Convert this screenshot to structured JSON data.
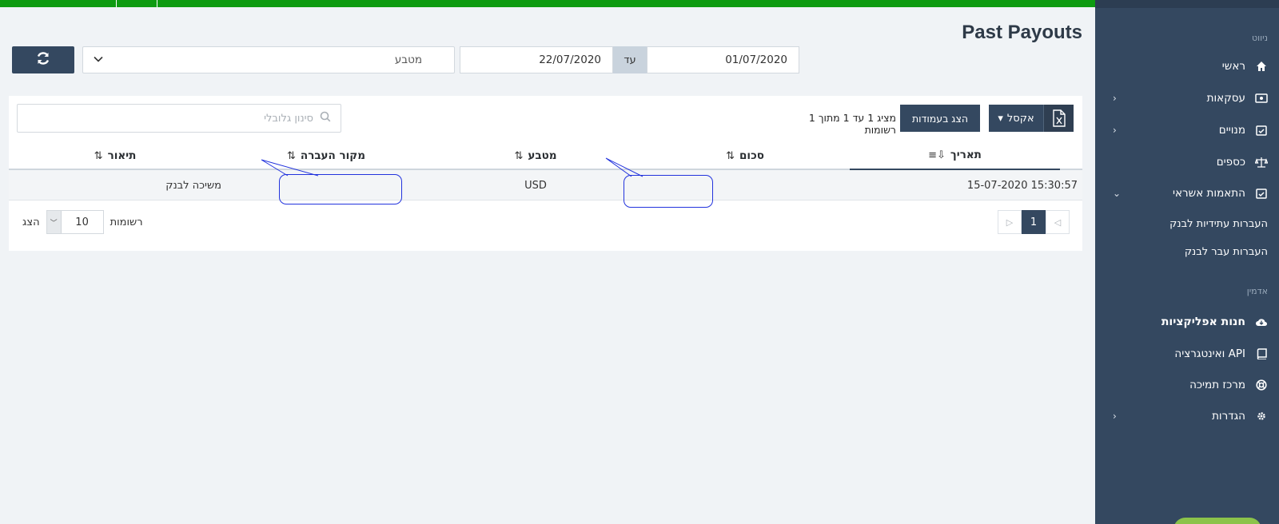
{
  "header": {
    "title": "Past Payouts"
  },
  "filters": {
    "refresh_icon": "refresh-icon",
    "currency_placeholder": "מטבע",
    "date_from": "01/07/2020",
    "date_to": "22/07/2020",
    "date_separator": "עד"
  },
  "toolbar": {
    "excel_label": "אקסל",
    "columns_label": "הצג בעמודות",
    "records_info": "מציג 1 עד 1 מתוך 1 רשומות",
    "search_placeholder": "סינון גלובלי"
  },
  "table": {
    "columns": [
      "תאריך",
      "סכום",
      "מטבע",
      "מקור העברה",
      "תיאור"
    ],
    "rows": [
      {
        "date": "15-07-2020 15:30:57",
        "amount": "",
        "currency": "USD",
        "source": "",
        "description": "משיכה לבנק"
      }
    ]
  },
  "pagination": {
    "current_page": "1",
    "show_label": "הצג",
    "page_size": "10",
    "records_label": "רשומות"
  },
  "sidebar": {
    "nav_section": "ניווט",
    "admin_section": "אדמין",
    "items": [
      {
        "label": "ראשי",
        "icon": "home-icon"
      },
      {
        "label": "עסקאות",
        "icon": "money-icon"
      },
      {
        "label": "מנויים",
        "icon": "calendar-check-icon"
      },
      {
        "label": "כספים",
        "icon": "scale-icon"
      },
      {
        "label": "התאמות אשראי",
        "icon": "calendar-check-icon"
      },
      {
        "label": "העברות עתידיות לבנק",
        "icon": ""
      },
      {
        "label": "העברות עבר לבנק",
        "icon": ""
      },
      {
        "label": "חנות אפליקציות",
        "icon": "cloud-download-icon"
      },
      {
        "label": "API ואינטגרציה",
        "icon": "book-icon"
      },
      {
        "label": "מרכז תמיכה",
        "icon": "lifebuoy-icon"
      },
      {
        "label": "הגדרות",
        "icon": "gear-icon"
      }
    ]
  },
  "colors": {
    "sidebar_bg": "#344860",
    "topbar": "#0e9b11",
    "annotation_arrow": "#e02020",
    "callout": "#2233dd"
  }
}
